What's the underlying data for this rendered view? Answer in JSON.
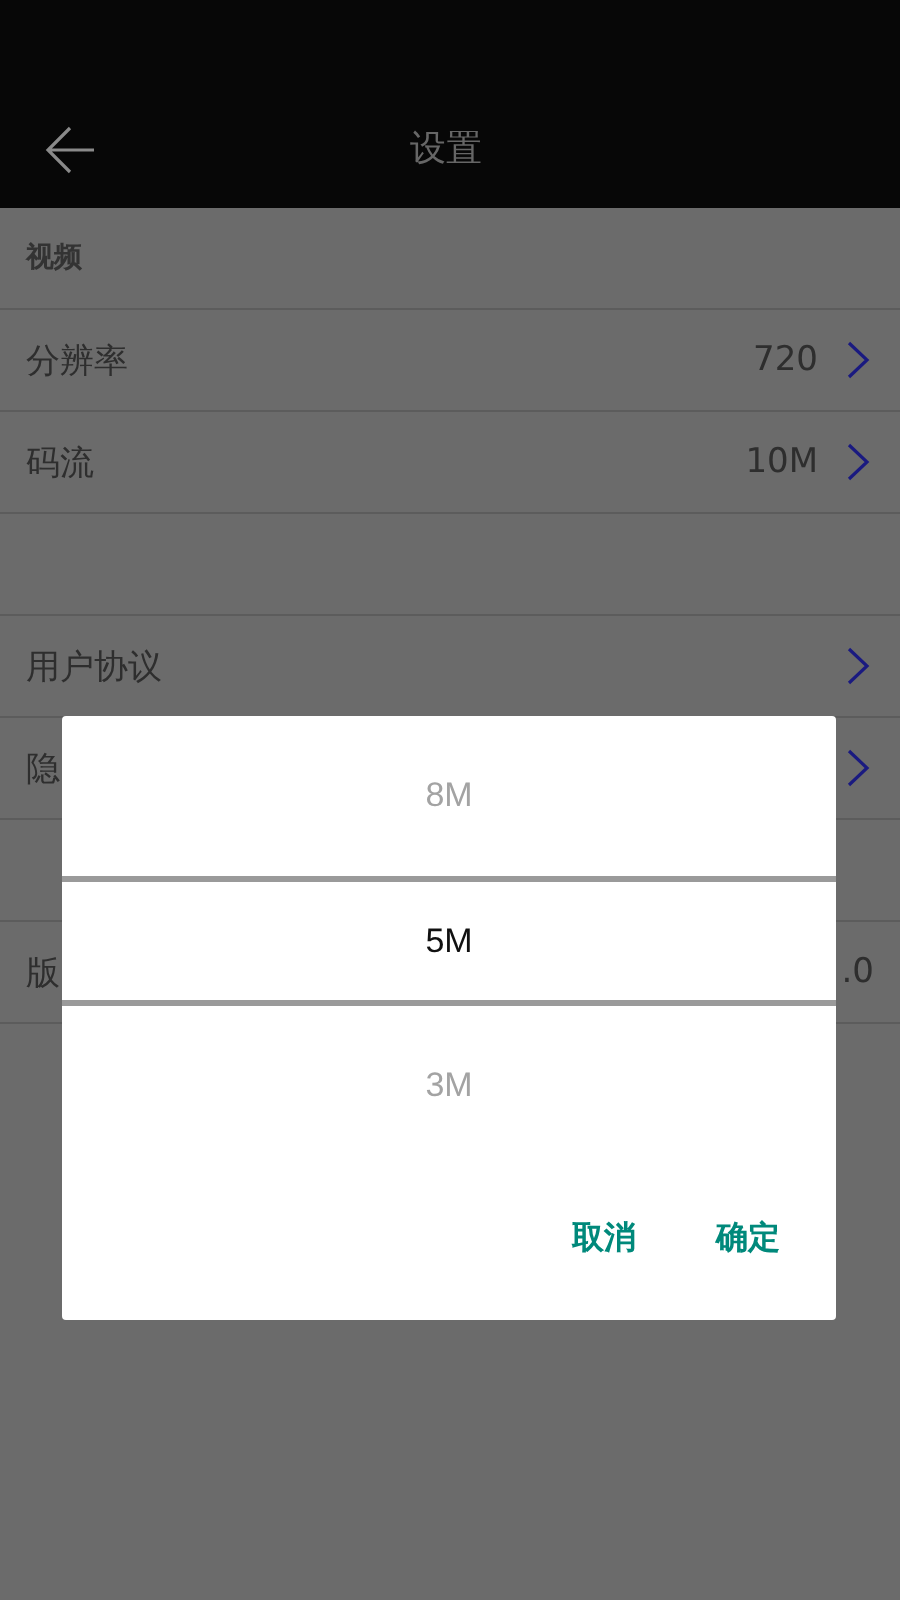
{
  "header": {
    "title": "设置"
  },
  "rows": [
    {
      "kind": "section",
      "label": "视频"
    },
    {
      "kind": "item",
      "label": "分辨率",
      "value": "720",
      "chevron": true
    },
    {
      "kind": "item",
      "label": "码流",
      "value": "10M",
      "chevron": true
    },
    {
      "kind": "gap"
    },
    {
      "kind": "item",
      "label": "用户协议",
      "chevron": true
    },
    {
      "kind": "item",
      "label": "隐",
      "chevron": true
    },
    {
      "kind": "gap"
    },
    {
      "kind": "item",
      "label": "版",
      "value": ".0",
      "chevron": false
    }
  ],
  "dialog": {
    "options": [
      {
        "label": "8M",
        "selected": false
      },
      {
        "label": "5M",
        "selected": true
      },
      {
        "label": "3M",
        "selected": false
      }
    ],
    "buttons": [
      "取消",
      "确定"
    ]
  }
}
